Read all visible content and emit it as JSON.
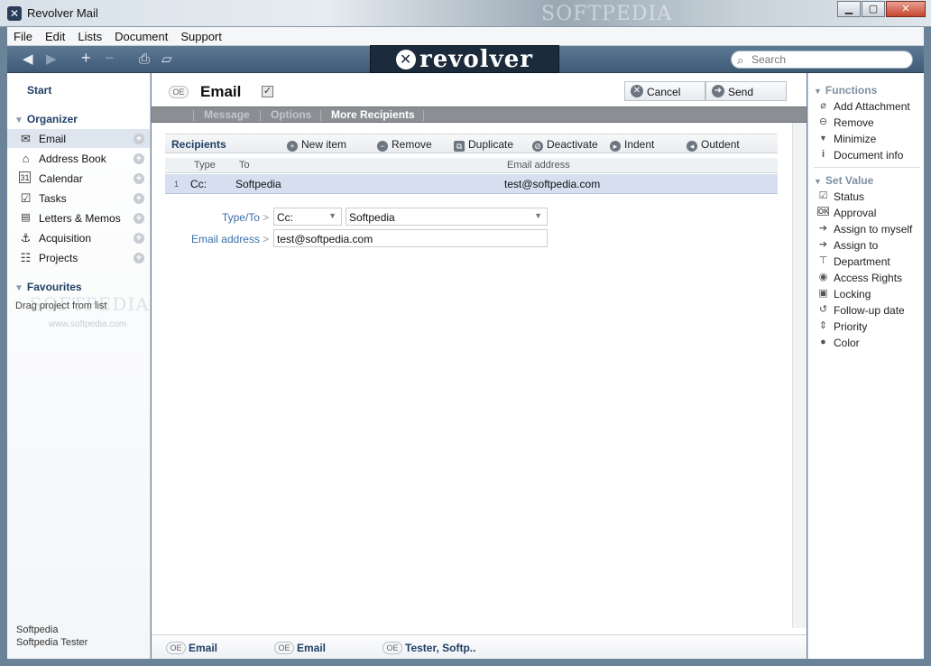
{
  "window": {
    "title": "Revolver Mail",
    "watermark": "SOFTPEDIA",
    "minimize": "▁",
    "maximize": "▢",
    "close": "✕"
  },
  "menu": [
    "File",
    "Edit",
    "Lists",
    "Document",
    "Support"
  ],
  "toolbar": {
    "brand": "revolver",
    "search_placeholder": "Search"
  },
  "sidebar": {
    "start": "Start",
    "organizer": "Organizer",
    "items": [
      {
        "label": "Email",
        "icon": "envelope-icon"
      },
      {
        "label": "Address Book",
        "icon": "house-icon"
      },
      {
        "label": "Calendar",
        "icon": "calendar-icon"
      },
      {
        "label": "Tasks",
        "icon": "checkbox-icon"
      },
      {
        "label": "Letters & Memos",
        "icon": "letter-icon"
      },
      {
        "label": "Acquisition",
        "icon": "anchor-icon"
      },
      {
        "label": "Projects",
        "icon": "projects-icon"
      }
    ],
    "favourites": "Favourites",
    "favourites_hint": "Drag project from list",
    "watermark": "SOFTPEDIA",
    "watermark_url": "www.softpedia.com",
    "user_line1": "Softpedia",
    "user_line2": "Softpedia Tester"
  },
  "document": {
    "badge": "OE",
    "title": "Email",
    "cancel": "Cancel",
    "send": "Send",
    "tabs": [
      "Message",
      "Options",
      "More Recipients"
    ],
    "active_tab": "More Recipients"
  },
  "recipients": {
    "title": "Recipients",
    "actions": [
      "New item",
      "Remove",
      "Duplicate",
      "Deactivate",
      "Indent",
      "Outdent"
    ],
    "columns": {
      "type": "Type",
      "to": "To",
      "email": "Email address"
    },
    "rows": [
      {
        "num": "1",
        "type": "Cc:",
        "to": "Softpedia",
        "email": "test@softpedia.com"
      }
    ]
  },
  "form": {
    "type_to_label": "Type/To",
    "type_value": "Cc:",
    "to_value": "Softpedia",
    "email_label": "Email address",
    "email_value": "test@softpedia.com",
    "arrow": ">"
  },
  "footer_tabs": [
    "Email",
    "Email",
    "Tester, Softp.."
  ],
  "right": {
    "functions_title": "Functions",
    "functions": [
      {
        "label": "Add Attachment",
        "icon": "paperclip-icon"
      },
      {
        "label": "Remove",
        "icon": "remove-icon"
      },
      {
        "label": "Minimize",
        "icon": "minimize-icon"
      },
      {
        "label": "Document info",
        "icon": "info-icon"
      }
    ],
    "set_value_title": "Set Value",
    "set_values": [
      {
        "label": "Status",
        "icon": "checkbox-icon"
      },
      {
        "label": "Approval",
        "icon": "ok-icon"
      },
      {
        "label": "Assign to myself",
        "icon": "assign-self-icon"
      },
      {
        "label": "Assign to",
        "icon": "assign-to-icon"
      },
      {
        "label": "Department",
        "icon": "department-icon"
      },
      {
        "label": "Access Rights",
        "icon": "eye-icon"
      },
      {
        "label": "Locking",
        "icon": "lock-icon"
      },
      {
        "label": "Follow-up date",
        "icon": "refresh-icon"
      },
      {
        "label": "Priority",
        "icon": "priority-icon"
      },
      {
        "label": "Color",
        "icon": "drop-icon"
      }
    ]
  }
}
